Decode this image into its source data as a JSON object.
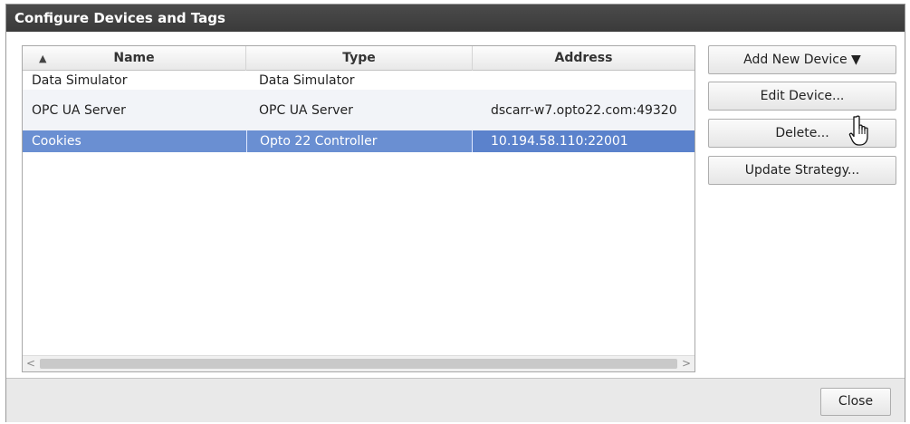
{
  "dialog": {
    "title": "Configure Devices and Tags"
  },
  "table": {
    "sort_icon": "sort-ascending-icon",
    "columns": [
      "Name",
      "Type",
      "Address"
    ],
    "rows": [
      {
        "name": "Data Simulator",
        "type": "Data Simulator",
        "address": ""
      },
      {
        "name": "OPC UA Server",
        "type": "OPC UA Server",
        "address": "dscarr-w7.opto22.com:49320"
      },
      {
        "name": "Cookies",
        "type": "Opto 22 Controller",
        "address": "10.194.58.110:22001"
      }
    ],
    "selected_row": 2,
    "scroll_left_icon": "chevron-left-icon",
    "scroll_right_icon": "chevron-right-icon"
  },
  "actions": {
    "add_label": "Add New Device ▼",
    "edit_label": "Edit Device...",
    "delete_label": "Delete...",
    "update_label": "Update Strategy..."
  },
  "footer": {
    "close_label": "Close"
  },
  "colors": {
    "titlebar": "#3f3f3f",
    "selection": "#6a8fd2",
    "footer": "#e9e9e9"
  },
  "cursor_icon": "hand-pointer-icon"
}
